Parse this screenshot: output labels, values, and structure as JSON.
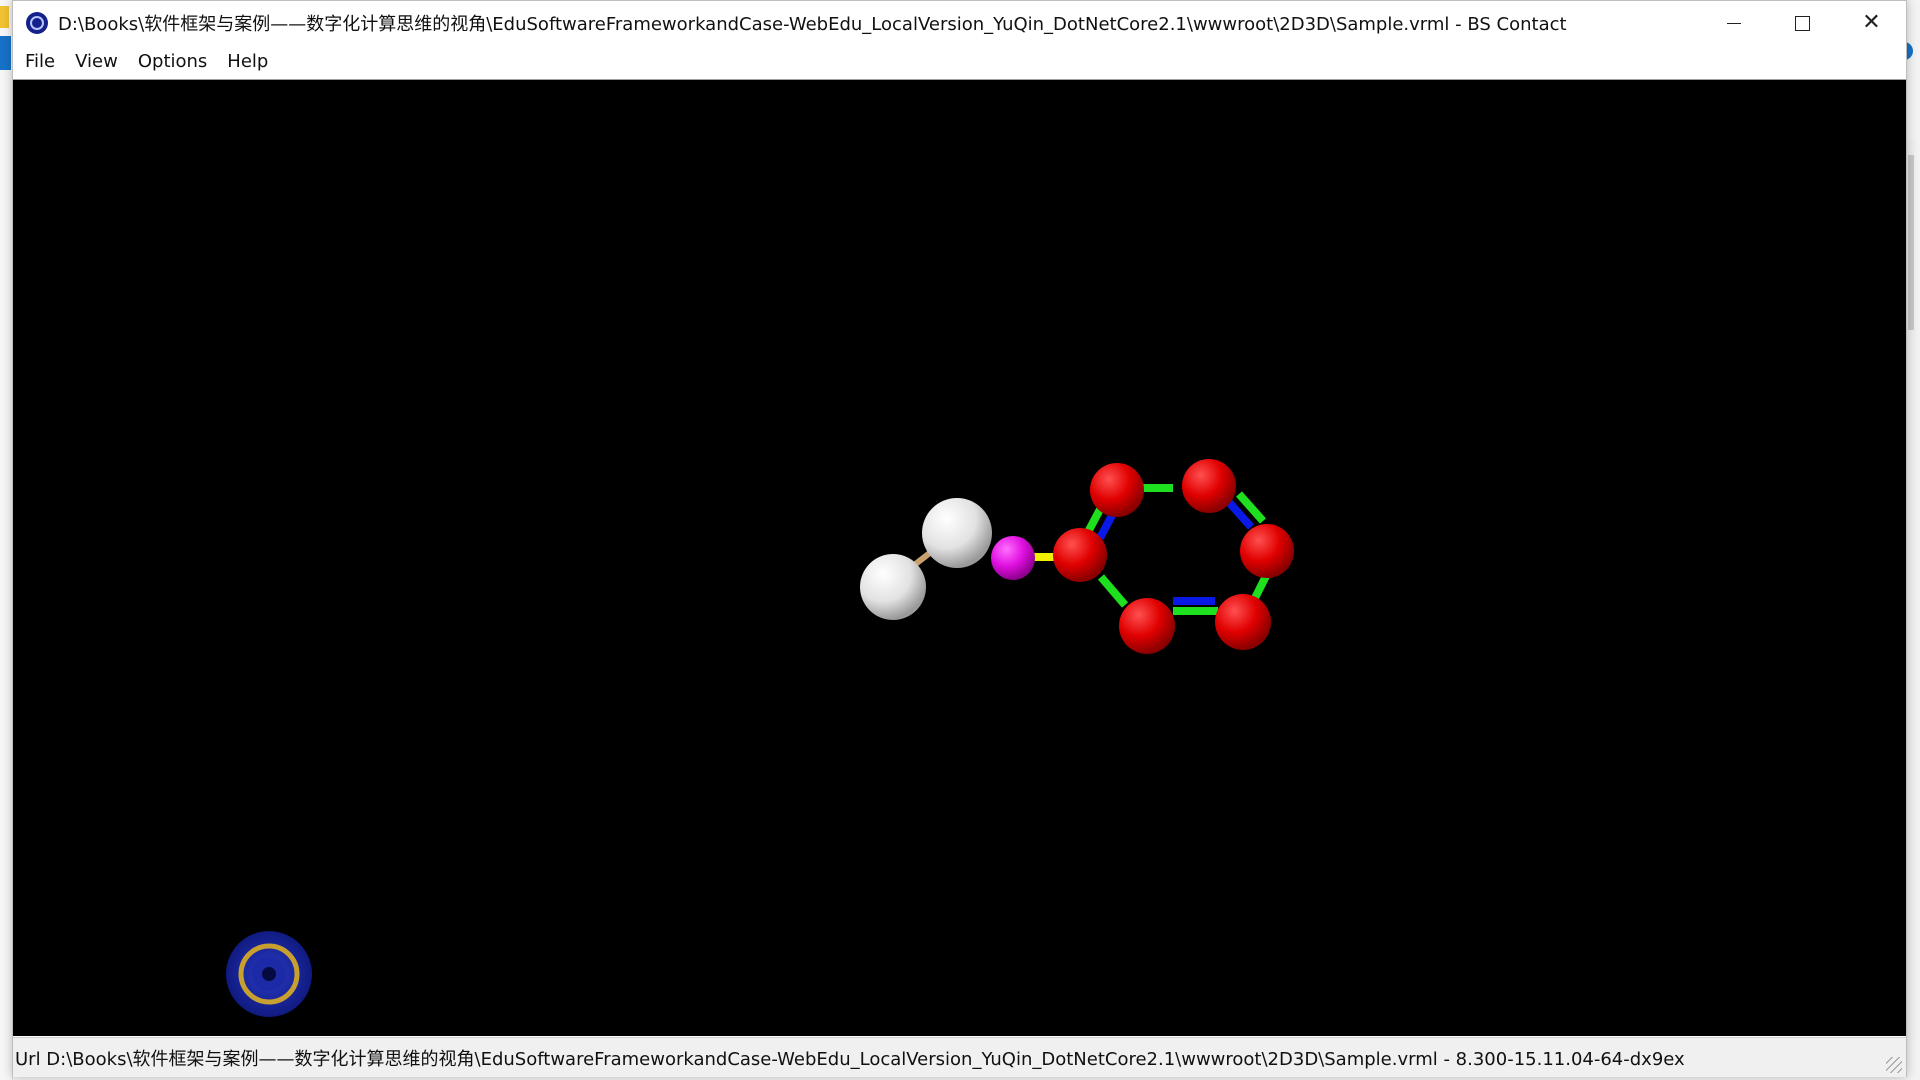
{
  "window": {
    "title": "D:\\Books\\软件框架与案例——数字化计算思维的视角\\EduSoftwareFrameworkandCase-WebEdu_LocalVersion_YuQin_DotNetCore2.1\\wwwroot\\2D3D\\Sample.vrml - BS Contact",
    "icon": "bs-contact-app-icon"
  },
  "controls": {
    "minimize_icon": "minimize-icon",
    "maximize_icon": "maximize-icon",
    "close_icon": "close-icon"
  },
  "menu": {
    "items": [
      {
        "label": "File"
      },
      {
        "label": "View"
      },
      {
        "label": "Options"
      },
      {
        "label": "Help"
      }
    ]
  },
  "scene": {
    "background": "#000000",
    "atom_colors": {
      "white": "#e8e8e8",
      "magenta": "#e010e0",
      "red": "#e00000"
    },
    "bond_colors": {
      "green": "#1ee01e",
      "blue": "#0a1ae6",
      "yellow": "#f0f000",
      "tan": "#c8a070"
    },
    "nav_widget": "navigation-compass-icon"
  },
  "status": {
    "text": "Url D:\\Books\\软件框架与案例——数字化计算思维的视角\\EduSoftwareFrameworkandCase-WebEdu_LocalVersion_YuQin_DotNetCore2.1\\wwwroot\\2D3D\\Sample.vrml  -  8.300-15.11.04-64-dx9ex"
  }
}
